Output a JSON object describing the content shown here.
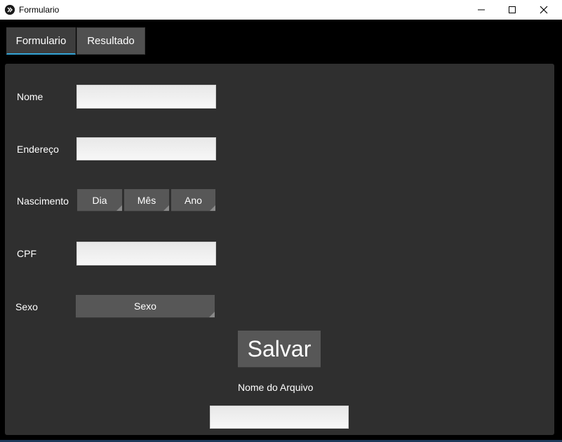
{
  "window": {
    "title": "Formulario"
  },
  "tabs": [
    {
      "label": "Formulario",
      "active": true
    },
    {
      "label": "Resultado",
      "active": false
    }
  ],
  "form": {
    "nome_label": "Nome",
    "nome_value": "",
    "endereco_label": "Endereço",
    "endereco_value": "",
    "nascimento_label": "Nascimento",
    "dia_label": "Dia",
    "mes_label": "Mês",
    "ano_label": "Ano",
    "cpf_label": "CPF",
    "cpf_value": "",
    "sexo_label": "Sexo",
    "sexo_select": "Sexo",
    "salvar_label": "Salvar",
    "arquivo_label": "Nome do Arquivo",
    "arquivo_value": ""
  },
  "colors": {
    "background": "#000000",
    "panel": "#2f2f2f",
    "button": "#575757",
    "tab_active_underline": "#33a3d6",
    "input": "#f0f0f0"
  },
  "icons": {
    "app": "app-icon",
    "minimize": "minimize-icon",
    "maximize": "maximize-icon",
    "close": "close-icon"
  }
}
